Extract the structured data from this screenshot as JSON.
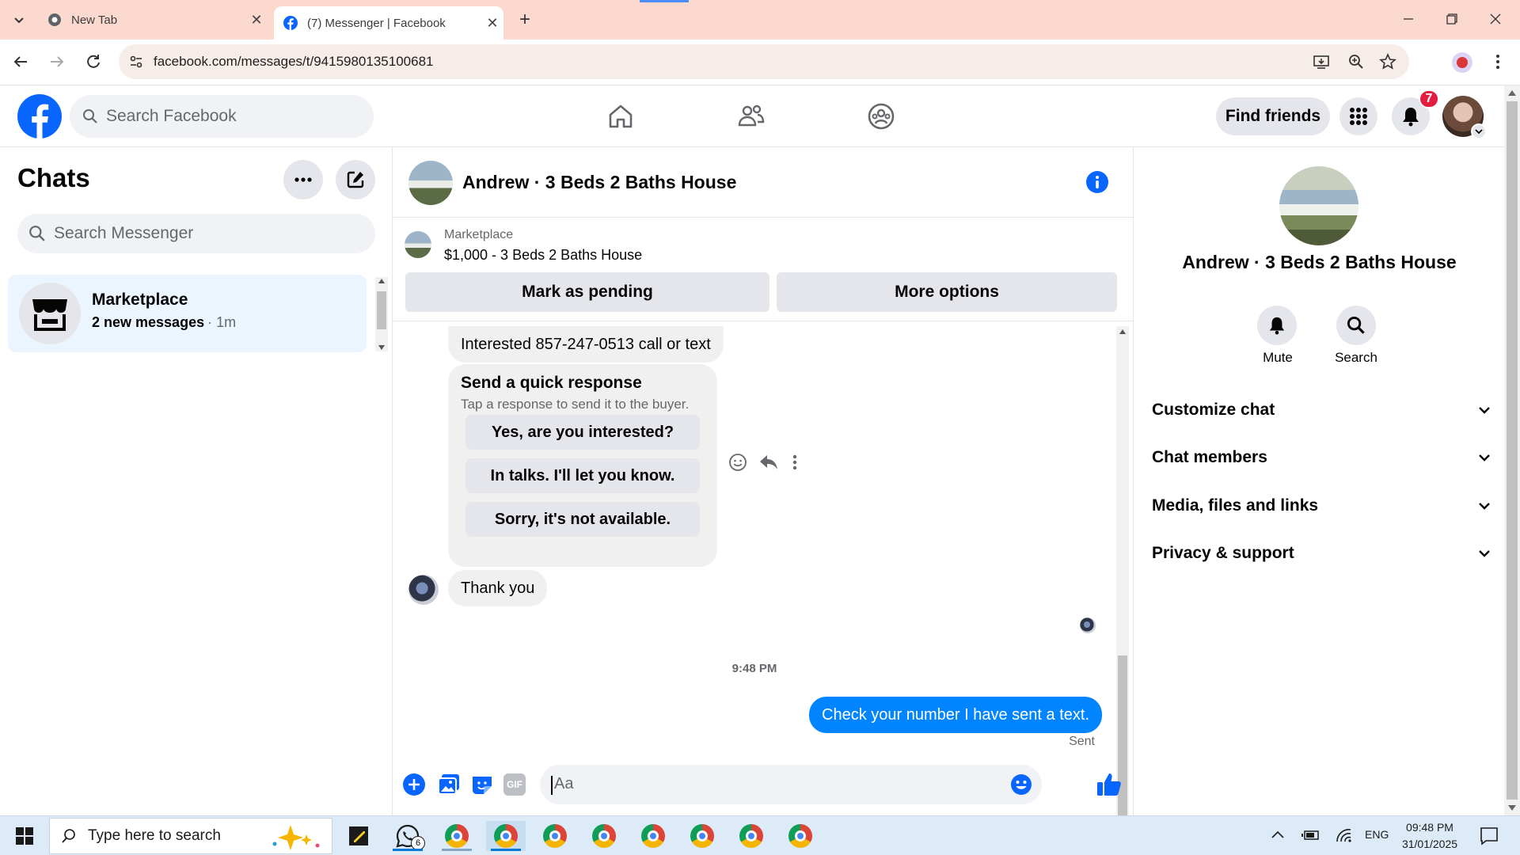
{
  "browser": {
    "tabs": [
      {
        "label": "New Tab",
        "favicon": "chrome-icon"
      },
      {
        "label": "(7) Messenger | Facebook",
        "favicon": "facebook-icon"
      }
    ],
    "url": "facebook.com/messages/t/9415980135100681"
  },
  "fb_header": {
    "search_placeholder": "Search Facebook",
    "find_friends": "Find friends",
    "notification_count": "7"
  },
  "chats": {
    "title": "Chats",
    "search_placeholder": "Search Messenger",
    "items": [
      {
        "name": "Marketplace",
        "preview": "2 new messages",
        "time": "· 1m"
      }
    ]
  },
  "conversation": {
    "title": "Andrew · 3 Beds 2 Baths House",
    "listing": {
      "source": "Marketplace",
      "price_title": "$1,000 - 3 Beds 2 Baths House",
      "mark_pending": "Mark as pending",
      "more_options": "More options"
    },
    "messages": {
      "interested": "Interested 857-247-0513 call or text",
      "quick_title": "Send a quick response",
      "quick_sub": "Tap a response to send it to the buyer.",
      "quick_options": [
        "Yes, are you interested?",
        "In talks. I'll let you know.",
        "Sorry, it's not available."
      ],
      "thank_you": "Thank you",
      "timestamp": "9:48 PM",
      "sent_msg": "Check your number I have sent a text.",
      "sent_status": "Sent"
    },
    "composer_placeholder": "Aa"
  },
  "details": {
    "name": "Andrew · 3 Beds 2 Baths House",
    "mute": "Mute",
    "search": "Search",
    "sections": [
      "Customize chat",
      "Chat members",
      "Media, files and links",
      "Privacy & support"
    ]
  },
  "taskbar": {
    "search_placeholder": "Type here to search",
    "whatsapp_badge": "6",
    "lang": "ENG",
    "time": "09:48 PM",
    "date": "31/01/2025"
  },
  "colors": {
    "fb_blue": "#0866ff",
    "messenger_blue": "#0084ff",
    "tab_bar": "#fcd9cf",
    "badge_red": "#e41e3f"
  }
}
